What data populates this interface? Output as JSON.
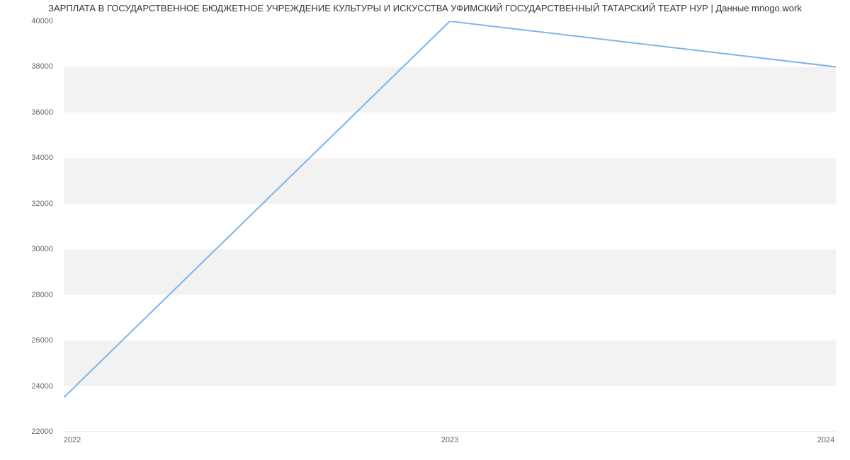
{
  "chart_data": {
    "type": "line",
    "title": "ЗАРПЛАТА В ГОСУДАРСТВЕННОЕ БЮДЖЕТНОЕ УЧРЕЖДЕНИЕ КУЛЬТУРЫ И ИСКУССТВА УФИМСКИЙ ГОСУДАРСТВЕННЫЙ ТАТАРСКИЙ ТЕАТР НУР | Данные mnogo.work",
    "xlabel": "",
    "ylabel": "",
    "categories": [
      "2022",
      "2023",
      "2024"
    ],
    "values": [
      23500,
      40000,
      38000
    ],
    "ylim": [
      22000,
      40000
    ],
    "y_ticks": [
      22000,
      24000,
      26000,
      28000,
      30000,
      32000,
      34000,
      36000,
      38000,
      40000
    ],
    "line_color": "#7cb5ec",
    "alt_band_color": "#f2f2f3"
  }
}
